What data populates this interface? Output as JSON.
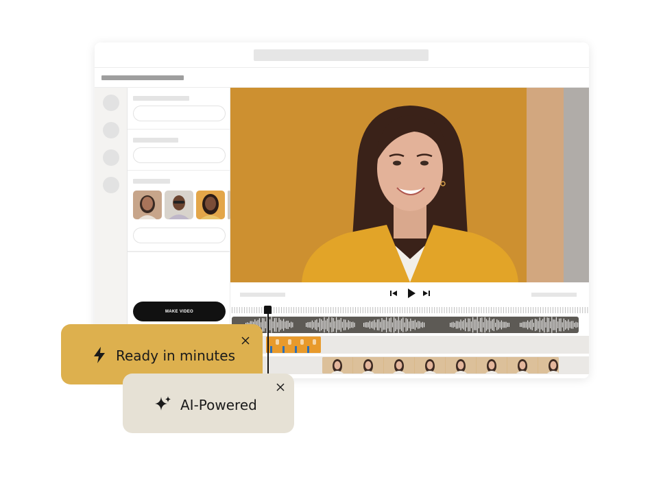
{
  "editor": {
    "make_video_label": "MAKE VIDEO"
  },
  "toasts": {
    "ready": {
      "label": "Ready in minutes",
      "icon": "lightning-icon"
    },
    "ai": {
      "label": "AI-Powered",
      "icon": "sparkle-icon"
    }
  },
  "colors": {
    "ready_toast_bg": "#ddb04e",
    "ai_toast_bg": "#e6e1d5",
    "button_bg": "#111111",
    "audio_track": "#5d5a55"
  }
}
